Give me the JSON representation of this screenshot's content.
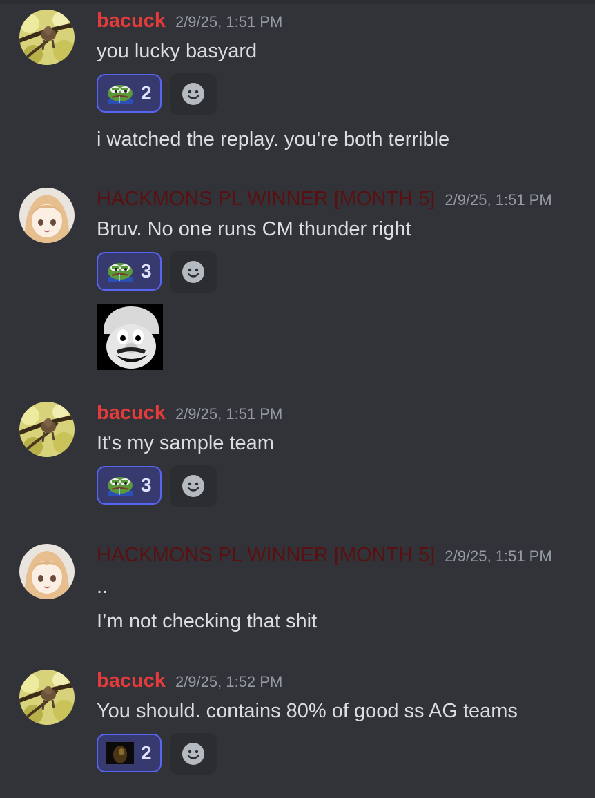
{
  "colors": {
    "background": "#313338",
    "bacuck_name": "#e23b3b",
    "hackmons_name": "#5a1010",
    "timestamp": "#949ba4",
    "reaction_border": "#5865f2",
    "reaction_bg": "#373a6f"
  },
  "messages": [
    {
      "username": "bacuck",
      "timestamp": "2/9/25, 1:51 PM",
      "lines": [
        "you lucky basyard",
        "i watched the replay. you're both terrible"
      ],
      "reaction": {
        "emoji": "pepe-frog-emoji",
        "count": "2"
      }
    },
    {
      "username": "HACKMONS PL WINNER [MONTH 5]",
      "timestamp": "2/9/25, 1:51 PM",
      "lines": [
        "Bruv. No one runs CM thunder right"
      ],
      "reaction": {
        "emoji": "pepe-frog-emoji",
        "count": "3"
      },
      "sticker": "scary-mario-face"
    },
    {
      "username": "bacuck",
      "timestamp": "2/9/25, 1:51 PM",
      "lines": [
        "It's my sample team"
      ],
      "reaction": {
        "emoji": "pepe-frog-emoji",
        "count": "3"
      }
    },
    {
      "username": "HACKMONS PL WINNER [MONTH 5]",
      "timestamp": "2/9/25, 1:51 PM",
      "lines": [
        "..",
        "I’m not checking that shit"
      ]
    },
    {
      "username": "bacuck",
      "timestamp": "2/9/25, 1:52 PM",
      "lines": [
        "You should. contains 80% of good ss AG teams"
      ],
      "reaction": {
        "emoji": "dark-face-emoji",
        "count": "2"
      }
    }
  ]
}
